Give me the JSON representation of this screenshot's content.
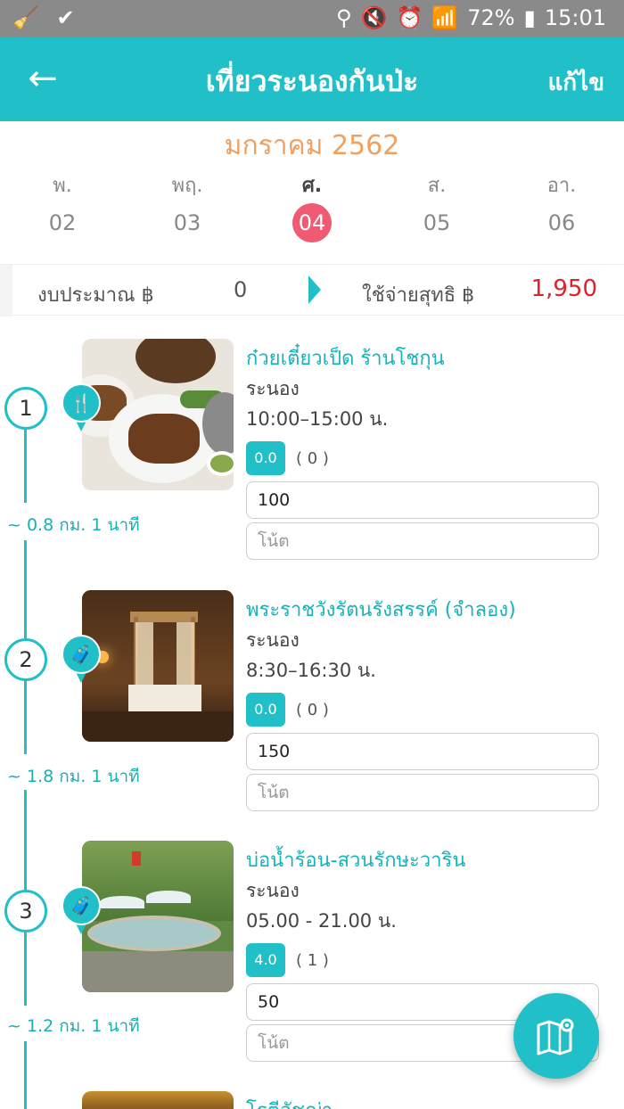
{
  "status_bar": {
    "battery": "72%",
    "time": "15:01"
  },
  "header": {
    "title": "เที่ยวระนองกันป่ะ",
    "edit_label": "แก้ไข"
  },
  "calendar": {
    "month": "มกราคม 2562",
    "days": [
      {
        "name": "พ.",
        "num": "02"
      },
      {
        "name": "พฤ.",
        "num": "03"
      },
      {
        "name": "ศ.",
        "num": "04"
      },
      {
        "name": "ส.",
        "num": "05"
      },
      {
        "name": "อา.",
        "num": "06"
      }
    ],
    "selected_index": 2
  },
  "budget": {
    "budget_label": "งบประมาณ ฿",
    "budget_value": "0",
    "spent_label": "ใช้จ่ายสุทธิ ฿",
    "spent_value": "1,950"
  },
  "places": [
    {
      "order": "1",
      "name": "ก๋วยเตี๋ยวเป็ด ร้านโชกุน",
      "province": "ระนอง",
      "hours": "10:00–15:00 น.",
      "rating": "0.0",
      "rating_count": "( 0 )",
      "cost": "100",
      "note_placeholder": "โน้ต",
      "category_icon": "restaurant-icon",
      "distance": "~ 0.8 กม. 1 นาที"
    },
    {
      "order": "2",
      "name": "พระราชวังรัตนรังสรรค์ (จำลอง)",
      "province": "ระนอง",
      "hours": "8:30–16:30 น.",
      "rating": "0.0",
      "rating_count": "( 0 )",
      "cost": "150",
      "note_placeholder": "โน้ต",
      "category_icon": "luggage-icon",
      "distance": "~ 1.8 กม. 1 นาที"
    },
    {
      "order": "3",
      "name": "บ่อน้ำร้อน-สวนรักษะวาริน",
      "province": "ระนอง",
      "hours": "05.00 - 21.00 น.",
      "rating": "4.0",
      "rating_count": "( 1 )",
      "cost": "50",
      "note_placeholder": "โน้ต",
      "category_icon": "luggage-icon",
      "distance": "~ 1.2 กม. 1 นาที"
    },
    {
      "name": "โรตีอัชฌ่า"
    }
  ],
  "colors": {
    "primary": "#21bfc7",
    "month": "#f0a060",
    "selected_day": "#f05a73",
    "spent": "#e0202a"
  }
}
